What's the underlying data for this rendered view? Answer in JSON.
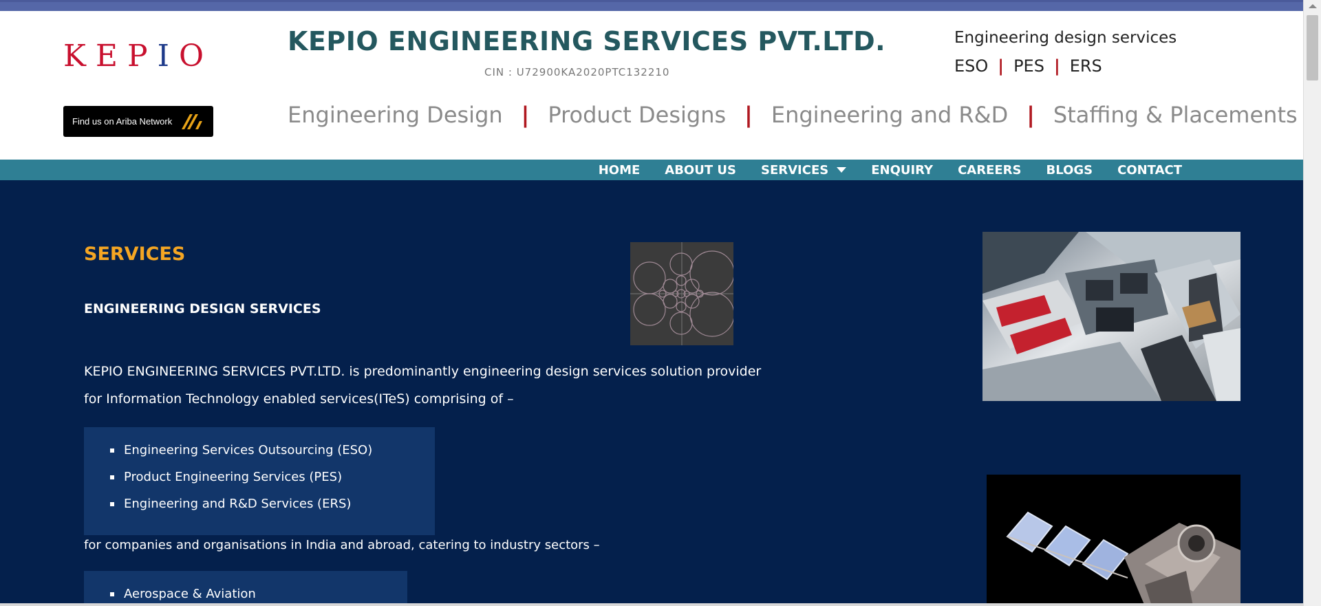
{
  "header": {
    "logo_text": "KEPIO",
    "ariba_label": "Find us on Ariba Network",
    "company_name": "KEPIO ENGINEERING SERVICES PVT.LTD.",
    "cin": "CIN : U72900KA2020PTC132210",
    "tagline": "Engineering design services",
    "tag_items": [
      "ESO",
      "PES",
      "ERS"
    ],
    "tag_separator": "|",
    "big_nav": [
      "Engineering Design",
      "Product Designs",
      "Engineering and R&D",
      "Staffing & Placements"
    ],
    "big_nav_separator": "|"
  },
  "menu": {
    "items": [
      "HOME",
      "ABOUT US",
      "SERVICES",
      "ENQUIRY",
      "CAREERS",
      "BLOGS",
      "CONTACT"
    ]
  },
  "main": {
    "section_title": "SERVICES",
    "subtitle": "ENGINEERING DESIGN SERVICES",
    "paragraph": "KEPIO ENGINEERING SERVICES PVT.LTD. is predominantly engineering design services solution provider for Information Technology enabled services(ITeS) comprising of –",
    "service_list": [
      "Engineering Services Outsourcing (ESO)",
      "Product Engineering Services (PES)",
      "Engineering and R&D Services (ERS)"
    ],
    "paragraph2": "for companies and organisations in India and abroad, catering to industry sectors –",
    "sector_list": [
      "Aerospace & Aviation"
    ]
  },
  "colors": {
    "brand_teal": "#24585f",
    "menu_bar": "#2f7f94",
    "main_bg": "#04204c",
    "accent_orange": "#f5a623",
    "separator_red": "#b01820"
  }
}
